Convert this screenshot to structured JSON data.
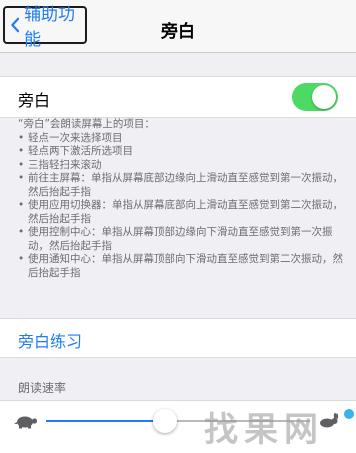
{
  "nav": {
    "back_label": "辅助功能",
    "title": "旁白"
  },
  "voiceover": {
    "label": "旁白",
    "enabled": true,
    "switch_color": "#4cd964"
  },
  "description": {
    "intro": "“旁白”会朗读屏幕上的项目：",
    "items": [
      "轻点一次来选择项目",
      "轻点两下激活所选项目",
      "三指轻扫来滚动",
      "前往主屏幕：单指从屏幕底部边缘向上滑动直至感觉到第一次振动，然后抬起手指",
      "使用应用切换器：单指从屏幕底部向上滑动直至感觉到第二次振动，然后抬起手指",
      "使用控制中心：单指从屏幕顶部边缘向下滑动直至感觉到第一次振动，然后抬起手指",
      "使用通知中心：单指从屏幕顶部向下滑动直至感觉到第二次振动，然后抬起手指"
    ]
  },
  "practice": {
    "label": "旁白练习"
  },
  "speaking_rate": {
    "header": "朗读速率",
    "value": 0.45,
    "slow_icon": "turtle-icon",
    "fast_icon": "hare-icon"
  },
  "watermark": {
    "text": "找果网"
  },
  "colors": {
    "accent": "#1f7cf3",
    "background": "#efeff4"
  }
}
